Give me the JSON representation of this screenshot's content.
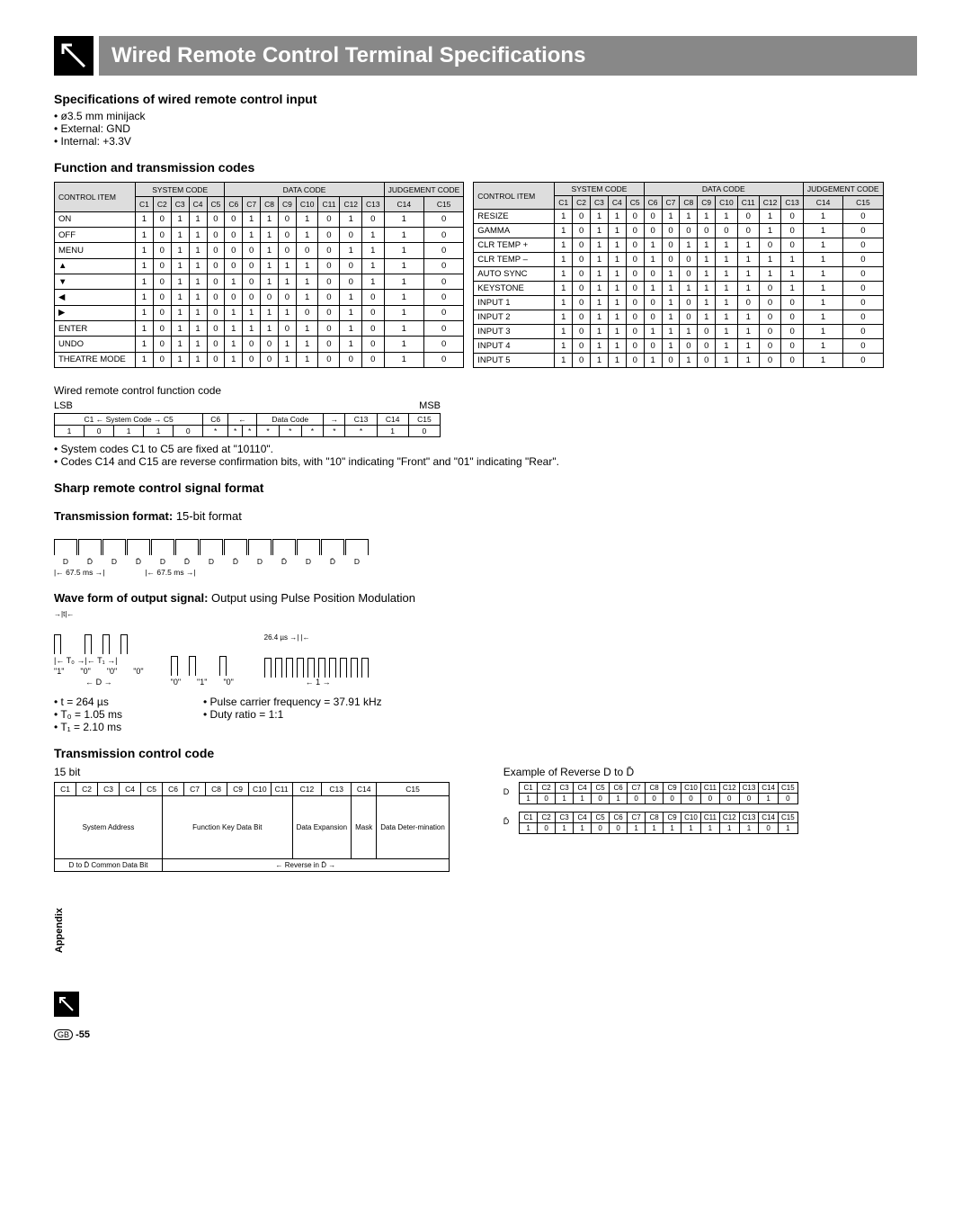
{
  "header": {
    "title": "Wired Remote Control Terminal Specifications"
  },
  "spec_section": {
    "title": "Specifications of wired remote control input",
    "items": [
      "ø3.5 mm minijack",
      "External: GND",
      "Internal: +3.3V"
    ]
  },
  "func_section": {
    "title": "Function and transmission codes",
    "col_groups": [
      "CONTROL ITEM",
      "SYSTEM CODE",
      "DATA CODE",
      "JUDGEMENT CODE"
    ],
    "cols": [
      "C1",
      "C2",
      "C3",
      "C4",
      "C5",
      "C6",
      "C7",
      "C8",
      "C9",
      "C10",
      "C11",
      "C12",
      "C13",
      "C14",
      "C15"
    ],
    "left_rows": [
      {
        "item": "ON",
        "v": [
          1,
          0,
          1,
          1,
          0,
          0,
          1,
          1,
          0,
          1,
          0,
          1,
          0,
          1,
          0
        ]
      },
      {
        "item": "OFF",
        "v": [
          1,
          0,
          1,
          1,
          0,
          0,
          1,
          1,
          0,
          1,
          0,
          0,
          1,
          1,
          0
        ]
      },
      {
        "item": "MENU",
        "v": [
          1,
          0,
          1,
          1,
          0,
          0,
          0,
          1,
          0,
          0,
          0,
          1,
          1,
          1,
          0
        ]
      },
      {
        "item": "▲",
        "v": [
          1,
          0,
          1,
          1,
          0,
          0,
          0,
          1,
          1,
          1,
          0,
          0,
          1,
          1,
          0
        ]
      },
      {
        "item": "▼",
        "v": [
          1,
          0,
          1,
          1,
          0,
          1,
          0,
          1,
          1,
          1,
          0,
          0,
          1,
          1,
          0
        ]
      },
      {
        "item": "◀",
        "v": [
          1,
          0,
          1,
          1,
          0,
          0,
          0,
          0,
          0,
          1,
          0,
          1,
          0,
          1,
          0
        ]
      },
      {
        "item": "▶",
        "v": [
          1,
          0,
          1,
          1,
          0,
          1,
          1,
          1,
          1,
          0,
          0,
          1,
          0,
          1,
          0
        ]
      },
      {
        "item": "ENTER",
        "v": [
          1,
          0,
          1,
          1,
          0,
          1,
          1,
          1,
          0,
          1,
          0,
          1,
          0,
          1,
          0
        ]
      },
      {
        "item": "UNDO",
        "v": [
          1,
          0,
          1,
          1,
          0,
          1,
          0,
          0,
          1,
          1,
          0,
          1,
          0,
          1,
          0
        ]
      },
      {
        "item": "THEATRE MODE",
        "v": [
          1,
          0,
          1,
          1,
          0,
          1,
          0,
          0,
          1,
          1,
          0,
          0,
          0,
          1,
          0
        ]
      }
    ],
    "right_rows": [
      {
        "item": "RESIZE",
        "v": [
          1,
          0,
          1,
          1,
          0,
          0,
          1,
          1,
          1,
          1,
          0,
          1,
          0,
          1,
          0
        ]
      },
      {
        "item": "GAMMA",
        "v": [
          1,
          0,
          1,
          1,
          0,
          0,
          0,
          0,
          0,
          0,
          0,
          1,
          0,
          1,
          0
        ]
      },
      {
        "item": "CLR TEMP +",
        "v": [
          1,
          0,
          1,
          1,
          0,
          1,
          0,
          1,
          1,
          1,
          1,
          0,
          0,
          1,
          0
        ]
      },
      {
        "item": "CLR TEMP –",
        "v": [
          1,
          0,
          1,
          1,
          0,
          1,
          0,
          0,
          1,
          1,
          1,
          1,
          1,
          1,
          0
        ]
      },
      {
        "item": "AUTO SYNC",
        "v": [
          1,
          0,
          1,
          1,
          0,
          0,
          1,
          0,
          1,
          1,
          1,
          1,
          1,
          1,
          0
        ]
      },
      {
        "item": "KEYSTONE",
        "v": [
          1,
          0,
          1,
          1,
          0,
          1,
          1,
          1,
          1,
          1,
          1,
          0,
          1,
          1,
          0
        ]
      },
      {
        "item": "INPUT 1",
        "v": [
          1,
          0,
          1,
          1,
          0,
          0,
          1,
          0,
          1,
          1,
          0,
          0,
          0,
          1,
          0
        ]
      },
      {
        "item": "INPUT 2",
        "v": [
          1,
          0,
          1,
          1,
          0,
          0,
          1,
          0,
          1,
          1,
          1,
          0,
          0,
          1,
          0
        ]
      },
      {
        "item": "INPUT 3",
        "v": [
          1,
          0,
          1,
          1,
          0,
          1,
          1,
          1,
          0,
          1,
          1,
          0,
          0,
          1,
          0
        ]
      },
      {
        "item": "INPUT 4",
        "v": [
          1,
          0,
          1,
          1,
          0,
          0,
          1,
          0,
          0,
          1,
          1,
          0,
          0,
          1,
          0
        ]
      },
      {
        "item": "INPUT 5",
        "v": [
          1,
          0,
          1,
          1,
          0,
          1,
          0,
          1,
          0,
          1,
          1,
          0,
          0,
          1,
          0
        ]
      }
    ]
  },
  "func_code": {
    "label": "Wired remote control function code",
    "lsb": "LSB",
    "msb": "MSB",
    "header_row": [
      "C1 ← System Code → C5",
      "C6",
      "←",
      "Data Code",
      "→",
      "C13",
      "C14",
      "C15"
    ],
    "value_row": [
      "1",
      "0",
      "1",
      "1",
      "0",
      "*",
      "*",
      "*",
      "*",
      "*",
      "*",
      "*",
      "*",
      "1",
      "0"
    ],
    "notes": [
      "System codes C1 to C5 are fixed at \"10110\".",
      "Codes C14 and C15 are reverse confirmation bits, with \"10\" indicating \"Front\" and \"01\" indicating \"Rear\"."
    ]
  },
  "signal_format": {
    "title": "Sharp remote control signal format",
    "transmission_label": "Transmission format:",
    "transmission_value": "15-bit format",
    "bit_seq": [
      "D",
      "D̄",
      "D",
      "D̄",
      "D",
      "D̄",
      "D",
      "D̄",
      "D",
      "D̄",
      "D",
      "D̄",
      "D"
    ],
    "span_label": "67.5 ms"
  },
  "waveform": {
    "label": "Wave form of output signal:",
    "value": "Output using Pulse Position Modulation",
    "left_labels": [
      "\"1\"",
      "\"0\"",
      "\"0\"",
      "\"0\""
    ],
    "t_labels": [
      "t",
      "T₀",
      "T₁"
    ],
    "d_label": "D",
    "mid_labels": [
      "\"0\"",
      "\"1\"",
      "\"0\""
    ],
    "right_t": "26.4 µs",
    "right_one": "1"
  },
  "timing": {
    "left": [
      "t = 264 µs",
      "T₀ = 1.05 ms",
      "T₁ = 2.10 ms"
    ],
    "right": [
      "Pulse carrier frequency = 37.91 kHz",
      "Duty ratio = 1:1"
    ]
  },
  "tcc": {
    "title": "Transmission control code",
    "fifteen": "15 bit",
    "cols": [
      "C1",
      "C2",
      "C3",
      "C4",
      "C5",
      "C6",
      "C7",
      "C8",
      "C9",
      "C10",
      "C11",
      "C12",
      "C13",
      "C14",
      "C15"
    ],
    "body": [
      "System Address",
      "Function Key Data Bit",
      "Data Expansion",
      "Mask",
      "Data Deter-mination"
    ],
    "common": "D to D̄ Common Data Bit",
    "reverse": "Reverse in D̄"
  },
  "rev_example": {
    "label": "Example of Reverse D to D̄",
    "d_prefix": "D",
    "dbar_prefix": "D̄",
    "cols": [
      "C1",
      "C2",
      "C3",
      "C4",
      "C5",
      "C6",
      "C7",
      "C8",
      "C9",
      "C10",
      "C11",
      "C12",
      "C13",
      "C14",
      "C15"
    ],
    "d_row": [
      1,
      0,
      1,
      1,
      0,
      1,
      0,
      0,
      0,
      0,
      0,
      0,
      0,
      1,
      0
    ],
    "dbar_row": [
      1,
      0,
      1,
      1,
      0,
      0,
      1,
      1,
      1,
      1,
      1,
      1,
      1,
      0,
      1
    ]
  },
  "sidebar": "Appendix",
  "page": "-55",
  "gb": "GB"
}
